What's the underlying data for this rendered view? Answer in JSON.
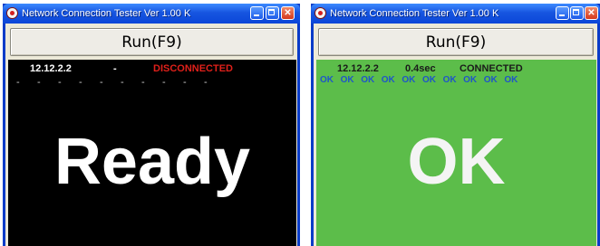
{
  "left_window": {
    "title": "Network Connection Tester Ver 1.00 K",
    "run_label": "Run(F9)",
    "ip": "12.12.2.2",
    "time": "-",
    "status": "DISCONNECTED",
    "status_color": "#e0201a",
    "panel_color": "#000000",
    "ping_results": [
      "-",
      "-",
      "-",
      "-",
      "-",
      "-",
      "-",
      "-",
      "-",
      "-"
    ],
    "big_text": "Ready"
  },
  "right_window": {
    "title": "Network Connection Tester Ver 1.00 K",
    "run_label": "Run(F9)",
    "ip": "12.12.2.2",
    "time": "0.4sec",
    "status": "CONNECTED",
    "panel_color": "#5cbd4a",
    "ping_results": [
      "OK",
      "OK",
      "OK",
      "OK",
      "OK",
      "OK",
      "OK",
      "OK",
      "OK",
      "OK"
    ],
    "ping_result_color": "#1f56c8",
    "big_text": "OK"
  }
}
